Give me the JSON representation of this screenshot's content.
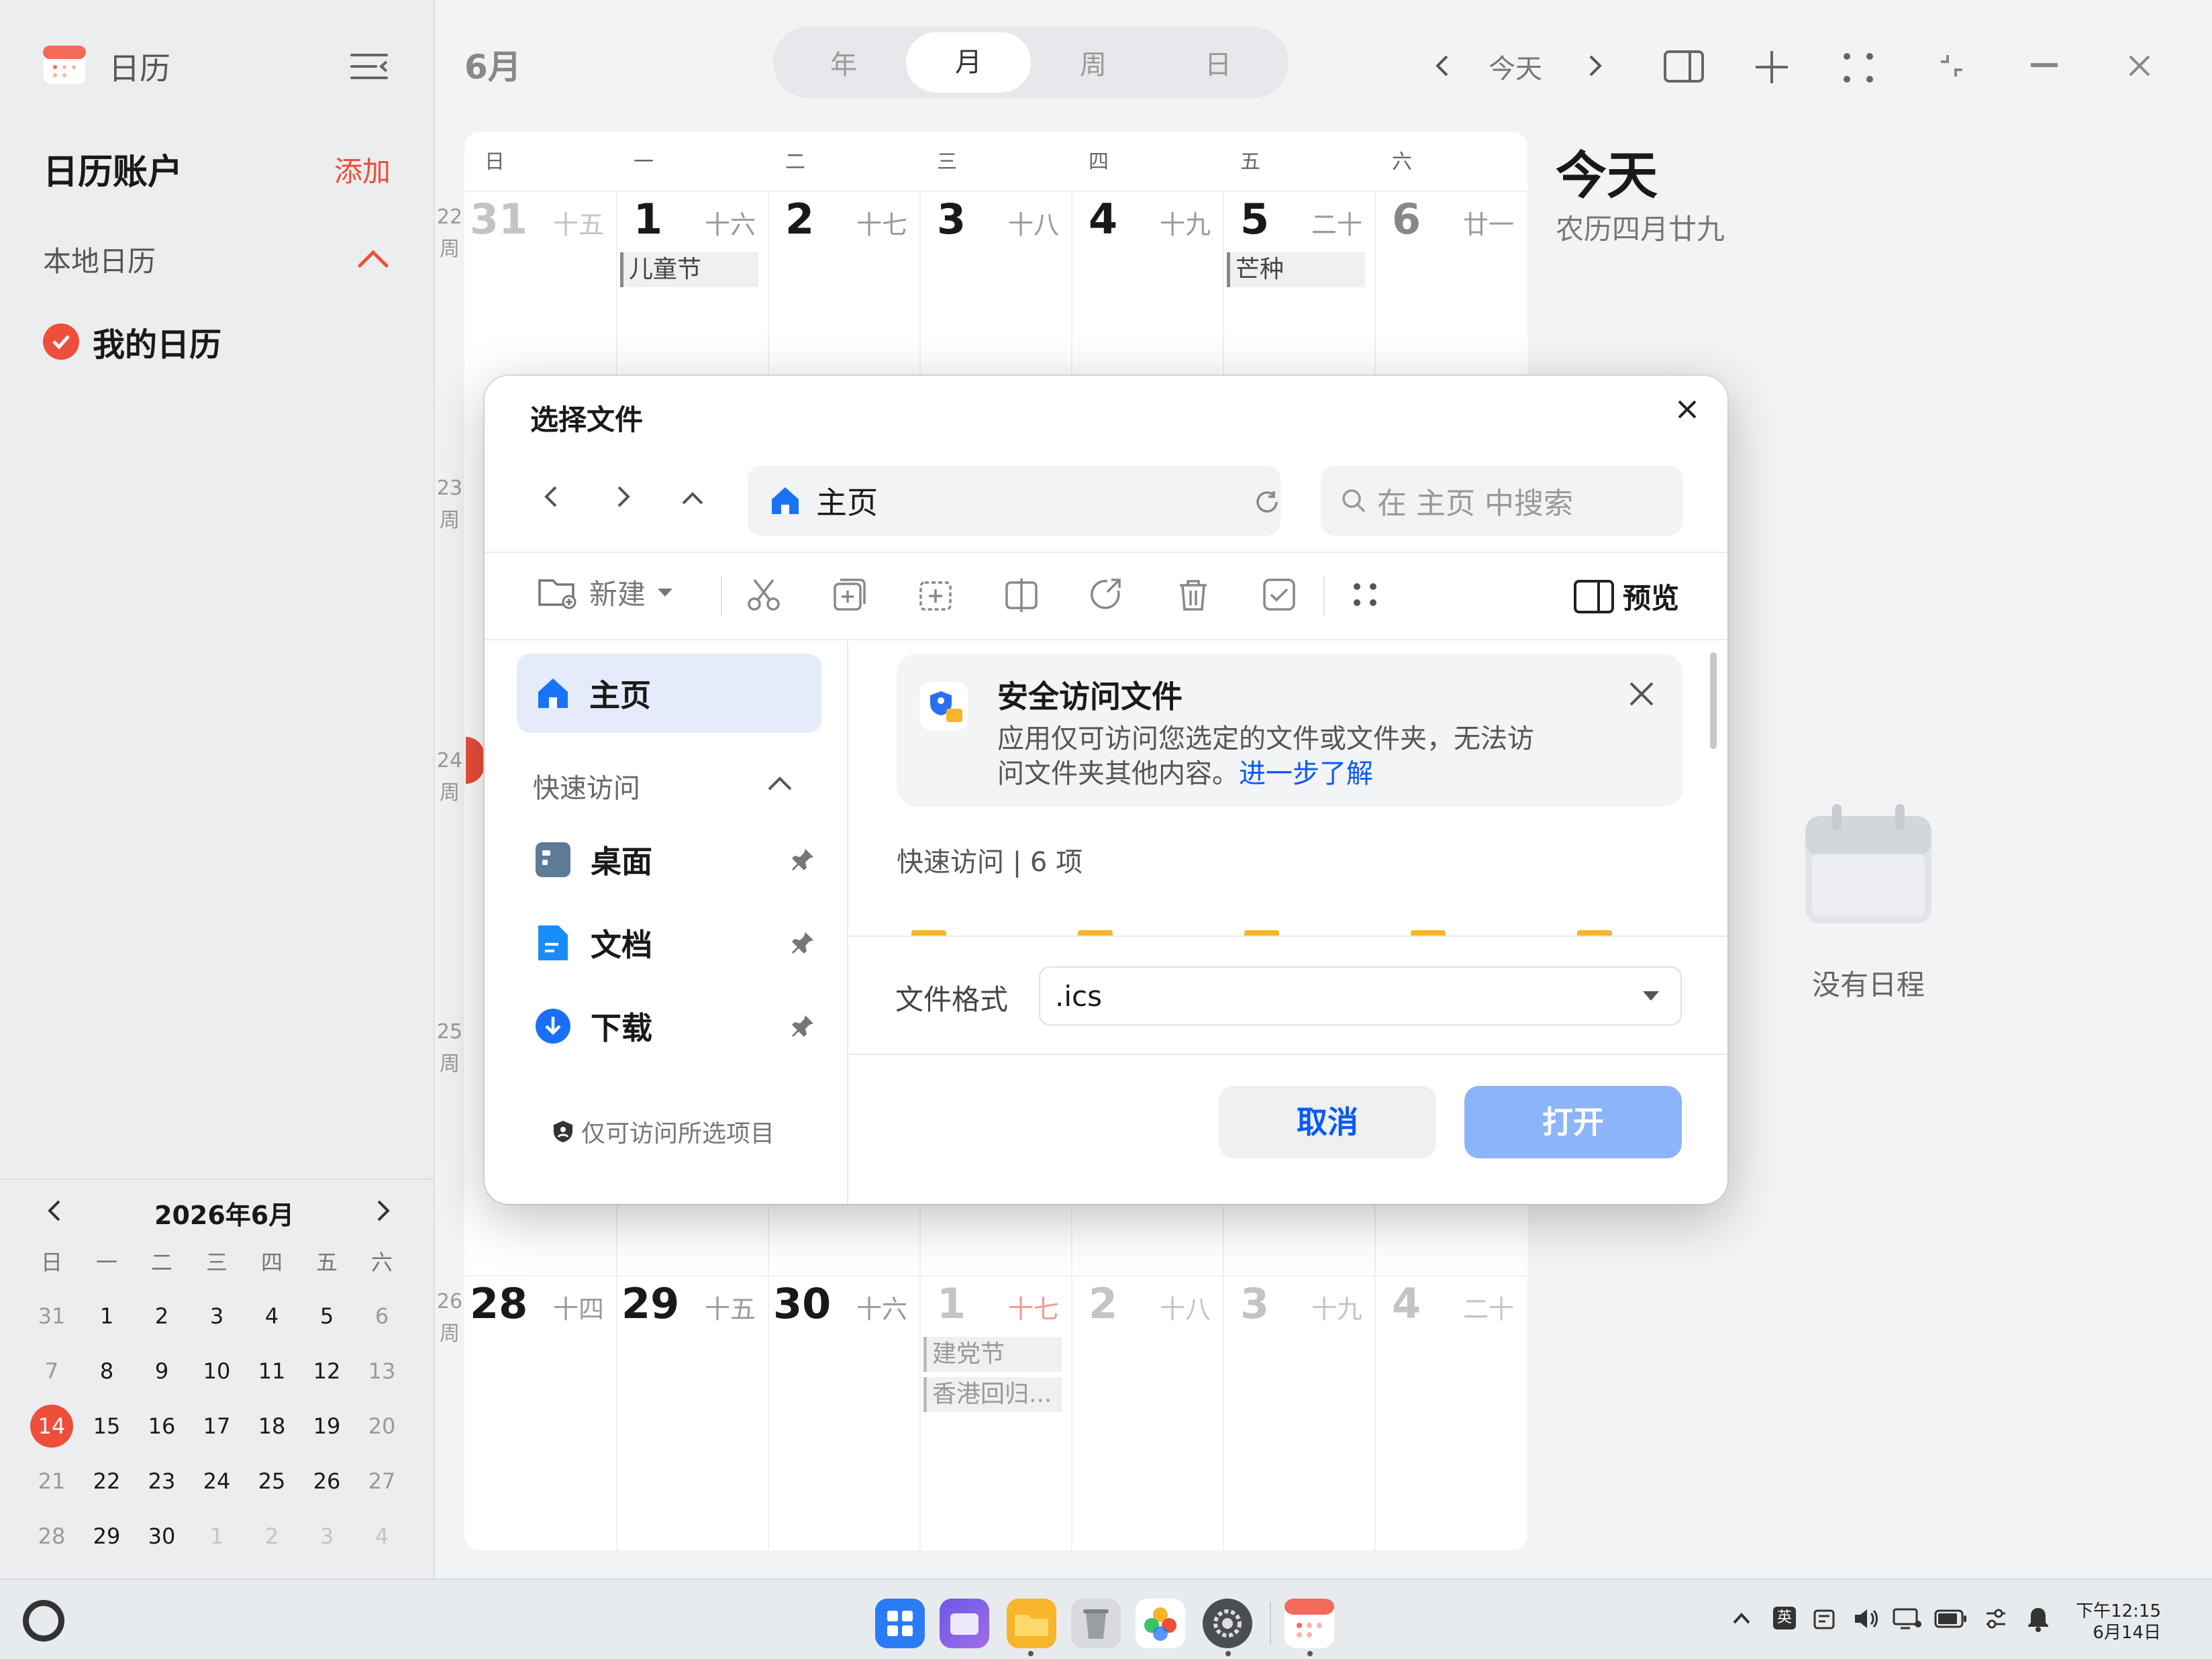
{
  "sidebar": {
    "app_title": "日历",
    "accounts_title": "日历账户",
    "add_label": "添加",
    "local_label": "本地日历",
    "my_calendar": "我的日历"
  },
  "mini_cal": {
    "title": "2026年6月",
    "weekdays": [
      "日",
      "一",
      "二",
      "三",
      "四",
      "五",
      "六"
    ],
    "rows": [
      [
        "31",
        "1",
        "2",
        "3",
        "4",
        "5",
        "6"
      ],
      [
        "7",
        "8",
        "9",
        "10",
        "11",
        "12",
        "13"
      ],
      [
        "14",
        "15",
        "16",
        "17",
        "18",
        "19",
        "20"
      ],
      [
        "21",
        "22",
        "23",
        "24",
        "25",
        "26",
        "27"
      ],
      [
        "28",
        "29",
        "30",
        "1",
        "2",
        "3",
        "4"
      ]
    ]
  },
  "header": {
    "month": "6月",
    "views": [
      "年",
      "月",
      "周",
      "日"
    ],
    "active_view": "月",
    "today": "今天"
  },
  "grid": {
    "weekdays": [
      "日",
      "一",
      "二",
      "三",
      "四",
      "五",
      "六"
    ],
    "week1": {
      "label": "22\n周",
      "days": [
        {
          "d": "31",
          "l": "十五"
        },
        {
          "d": "1",
          "l": "十六"
        },
        {
          "d": "2",
          "l": "十七"
        },
        {
          "d": "3",
          "l": "十八"
        },
        {
          "d": "4",
          "l": "十九"
        },
        {
          "d": "5",
          "l": "二十"
        },
        {
          "d": "6",
          "l": "廿一"
        }
      ]
    },
    "event_childrens": "儿童节",
    "event_mangzhong": "芒种",
    "weeks": [
      "23\n周",
      "24\n周",
      "25\n周"
    ],
    "last_week": {
      "label": "26\n周",
      "days": [
        {
          "d": "28",
          "l": "十四"
        },
        {
          "d": "29",
          "l": "十五"
        },
        {
          "d": "30",
          "l": "十六"
        },
        {
          "d": "1",
          "l": "十七"
        },
        {
          "d": "2",
          "l": "十八"
        },
        {
          "d": "3",
          "l": "十九"
        },
        {
          "d": "4",
          "l": "二十"
        }
      ]
    },
    "event_party": "建党节",
    "event_hk": "香港回归..."
  },
  "today_panel": {
    "title": "今天",
    "lunar": "农历四月廿九",
    "empty": "没有日程"
  },
  "dialog": {
    "title": "选择文件",
    "location": "主页",
    "search_placeholder": "在 主页 中搜索",
    "new_label": "新建",
    "preview_label": "预览",
    "nav": {
      "home": "主页",
      "quick_access": "快速访问",
      "desktop": "桌面",
      "documents": "文档",
      "downloads": "下载",
      "footer": "仅可访问所选项目"
    },
    "banner": {
      "title": "安全访问文件",
      "text1": "应用仅可访问您选定的文件或文件夹，无法访",
      "text2": "问文件夹其他内容。",
      "link": "进一步了解"
    },
    "section": "快速访问 | 6 项",
    "format_label": "文件格式",
    "format_value": ".ics",
    "cancel": "取消",
    "open": "打开"
  },
  "taskbar": {
    "time": "下午12:15",
    "date": "6月14日",
    "ime": "英"
  },
  "colors": {
    "accent": "#ee4e3a",
    "primary_blue": "#0a59f7",
    "open_btn": "#8cb4f8"
  }
}
